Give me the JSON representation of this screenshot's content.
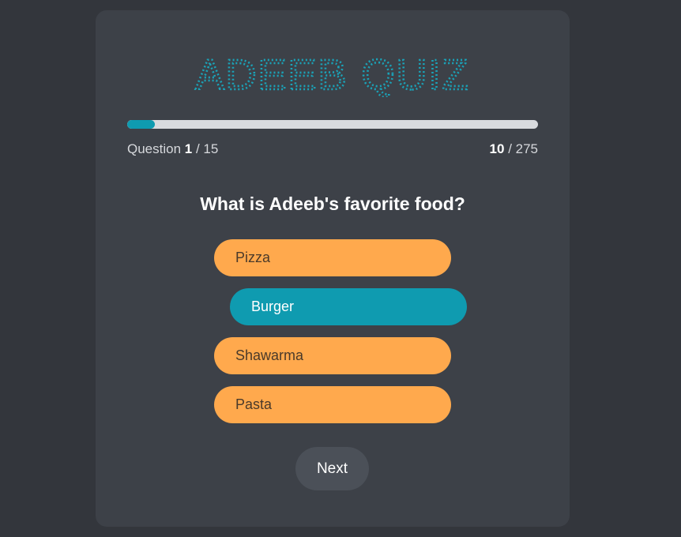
{
  "quiz": {
    "title": "ADEEB QUIZ",
    "accent_color": "#0f9bb0",
    "answer_color": "#ffa94d"
  },
  "progress": {
    "fraction": 0.0667,
    "question_label": "Question",
    "current_question": "1",
    "total_questions": "/ 15",
    "current_score": "10",
    "total_score": "/ 275"
  },
  "question": {
    "text": "What is Adeeb's favorite food?"
  },
  "answers": [
    {
      "label": "Pizza",
      "selected": false
    },
    {
      "label": "Burger",
      "selected": true
    },
    {
      "label": "Shawarma",
      "selected": false
    },
    {
      "label": "Pasta",
      "selected": false
    }
  ],
  "controls": {
    "next_label": "Next"
  }
}
